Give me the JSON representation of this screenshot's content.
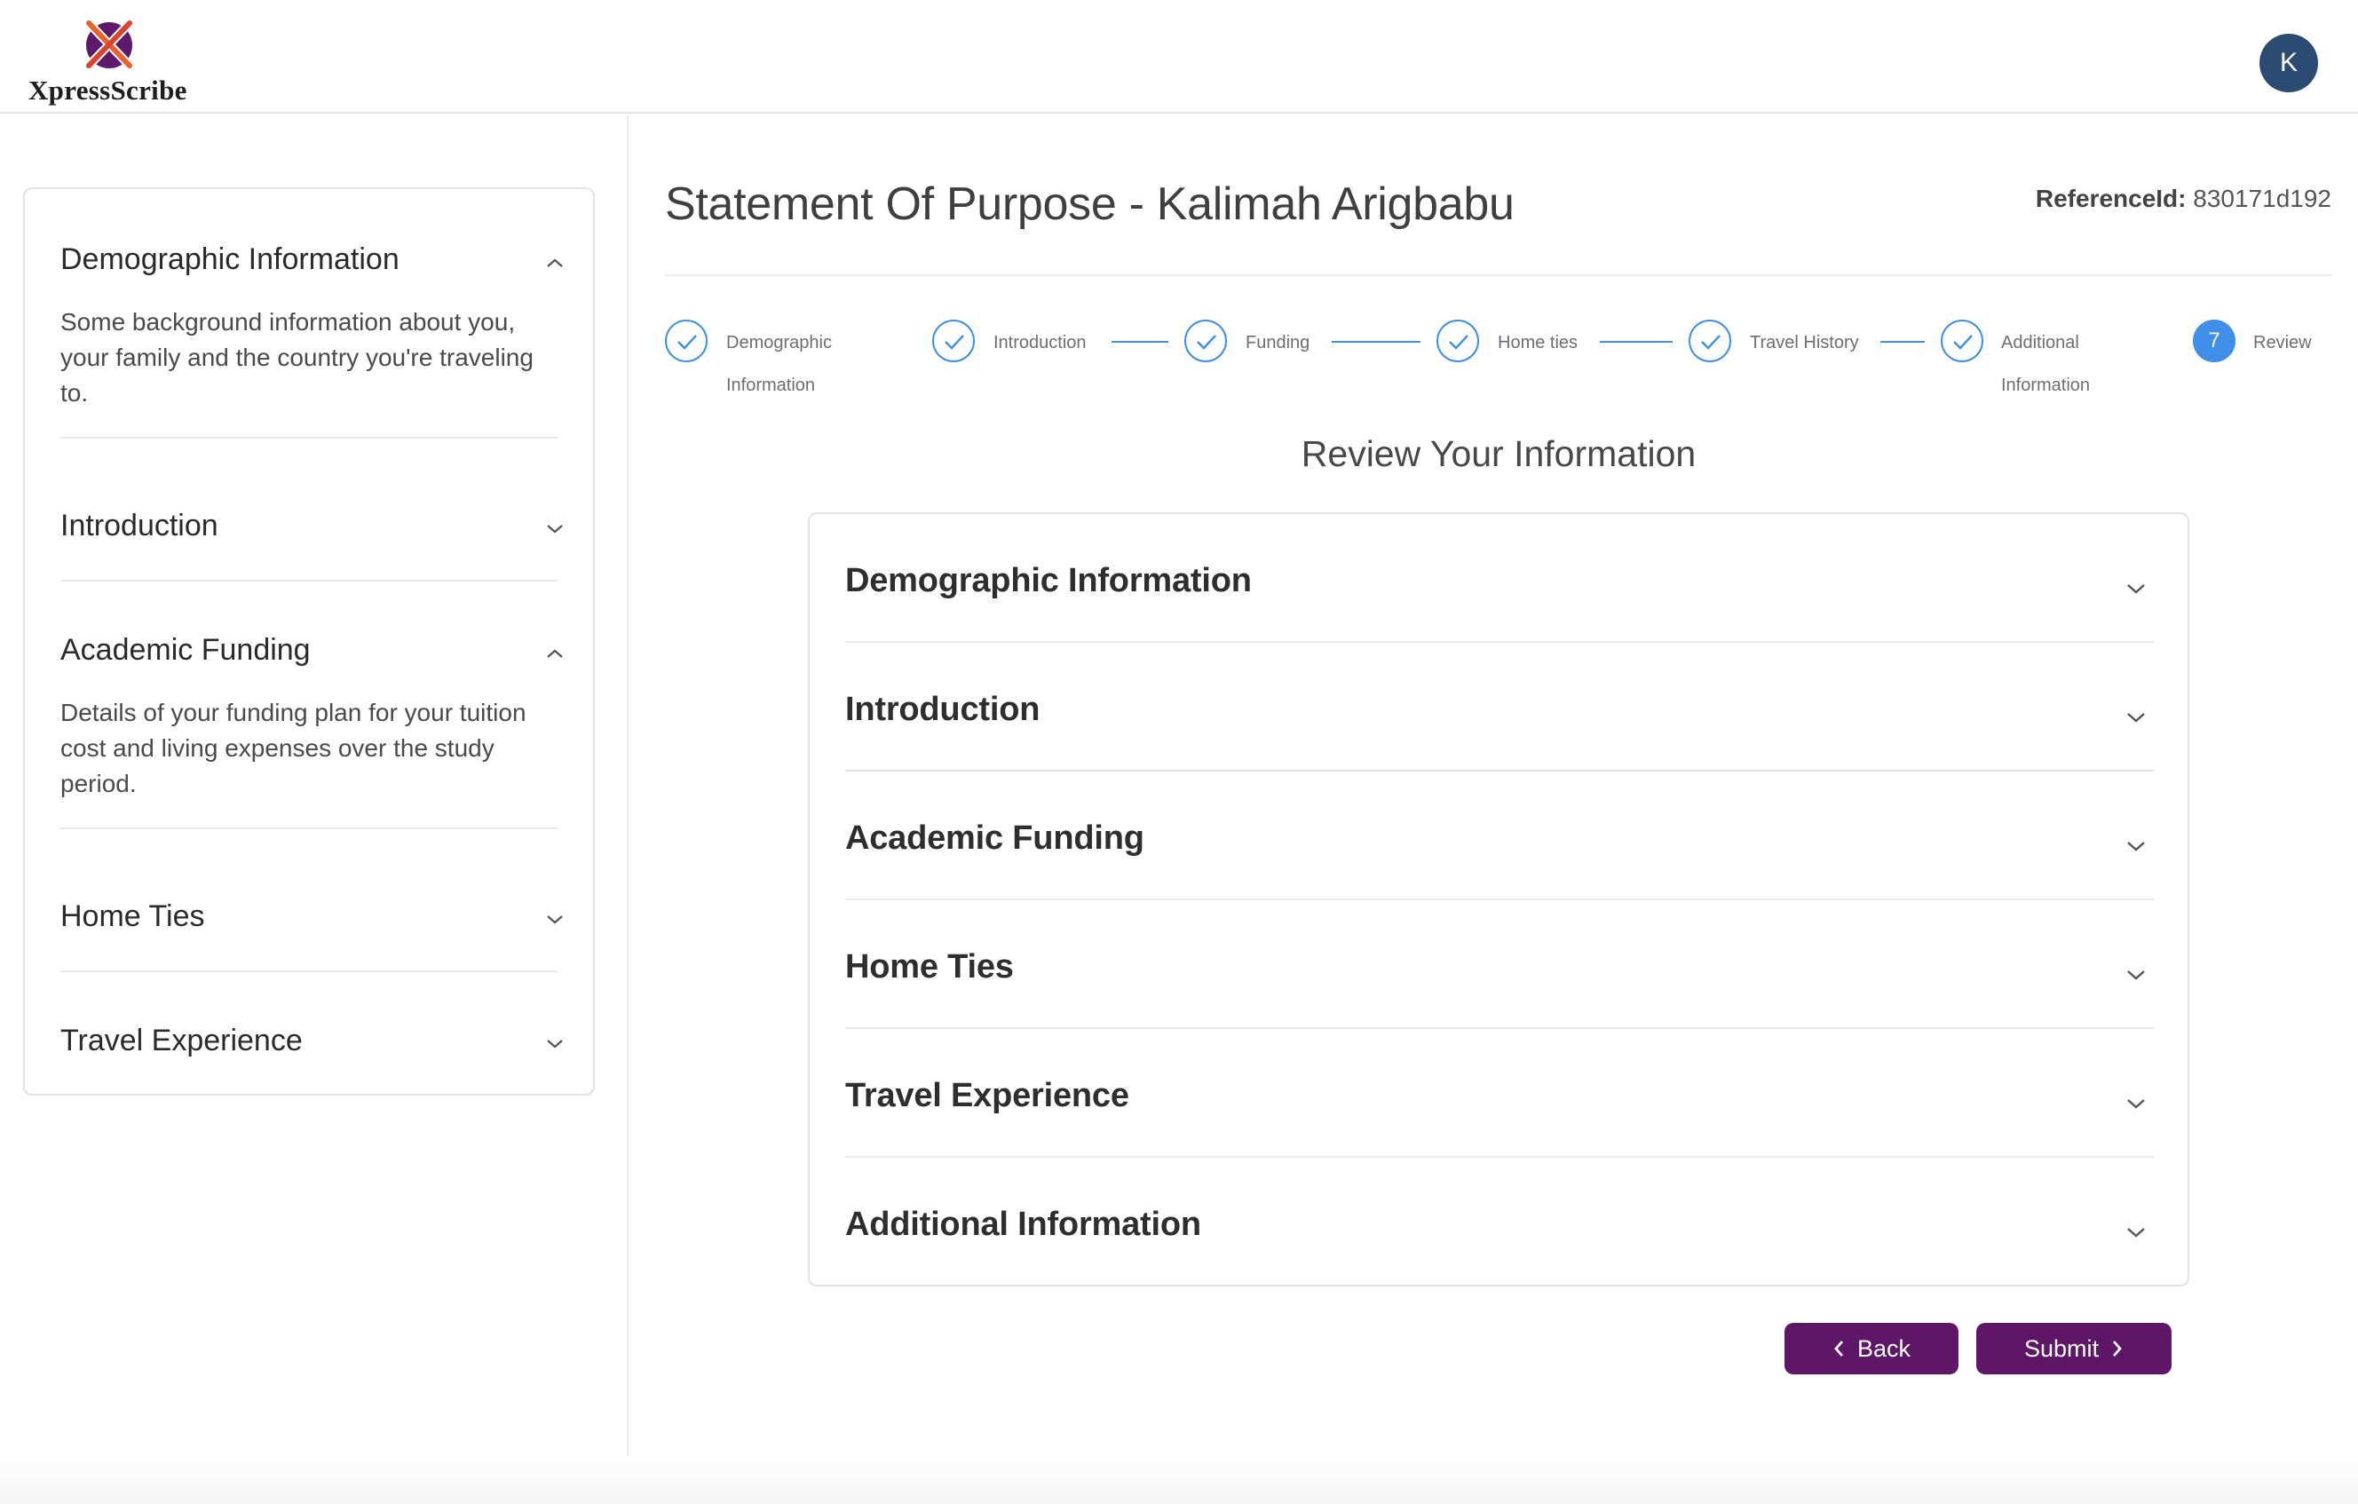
{
  "header": {
    "brand_name": "XpressScribe",
    "avatar_initial": "K"
  },
  "sidebar": {
    "items": [
      {
        "label": "Demographic Information",
        "expanded": true,
        "description": "Some background information about you, your family and the country you're traveling to."
      },
      {
        "label": "Introduction",
        "expanded": false
      },
      {
        "label": "Academic Funding",
        "expanded": true,
        "description": "Details of your funding plan for your tuition cost and living expenses over the study period."
      },
      {
        "label": "Home Ties",
        "expanded": false
      },
      {
        "label": "Travel Experience",
        "expanded": false
      }
    ]
  },
  "main": {
    "title": "Statement Of Purpose - Kalimah Arigbabu",
    "reference_label": "ReferenceId:",
    "reference_value": "830171d192",
    "stepper": [
      {
        "label_line1": "Demographic",
        "label_line2": "Information",
        "status": "done"
      },
      {
        "label_line1": "Introduction",
        "status": "done"
      },
      {
        "label_line1": "Funding",
        "status": "done"
      },
      {
        "label_line1": "Home ties",
        "status": "done"
      },
      {
        "label_line1": "Travel History",
        "status": "done"
      },
      {
        "label_line1": "Additional",
        "label_line2": "Information",
        "status": "done"
      },
      {
        "number": "7",
        "label_line1": "Review",
        "status": "active"
      }
    ],
    "review_title": "Review Your Information",
    "review_sections": [
      "Demographic Information",
      "Introduction",
      "Academic Funding",
      "Home Ties",
      "Travel Experience",
      "Additional Information"
    ],
    "back_label": "Back",
    "submit_label": "Submit"
  },
  "colors": {
    "accent_blue": "#3f8ee8",
    "button_purple": "#5e1766",
    "avatar_navy": "#2c4b72"
  }
}
